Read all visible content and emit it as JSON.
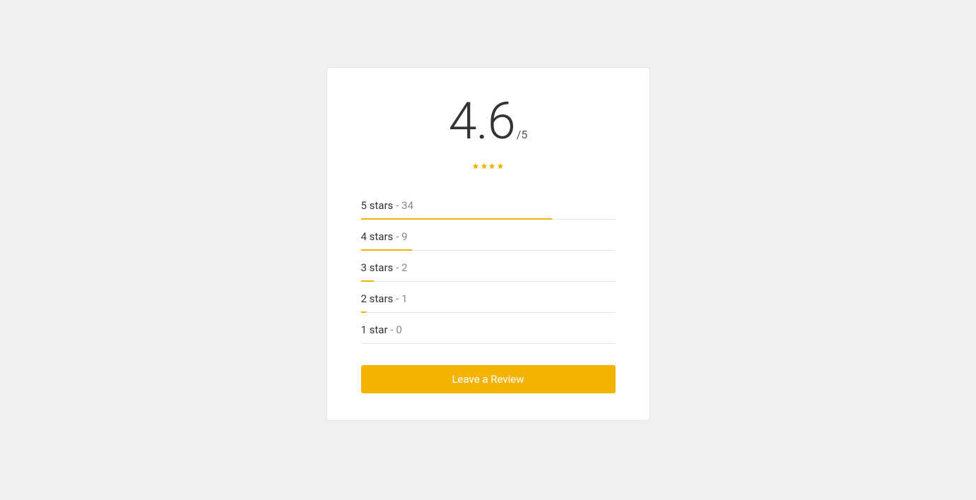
{
  "rating": {
    "average": "4.6",
    "max_suffix": "/5",
    "stars_filled": 4,
    "star_color": "#f5b301"
  },
  "breakdown": [
    {
      "label": "5 stars",
      "count": "34",
      "bar_percent": 75
    },
    {
      "label": "4 stars",
      "count": "9",
      "bar_percent": 20
    },
    {
      "label": "3 stars",
      "count": "2",
      "bar_percent": 5
    },
    {
      "label": "2 stars",
      "count": "1",
      "bar_percent": 2
    },
    {
      "label": "1 star",
      "count": "0",
      "bar_percent": 0
    }
  ],
  "button": {
    "leave_review": "Leave a Review"
  }
}
